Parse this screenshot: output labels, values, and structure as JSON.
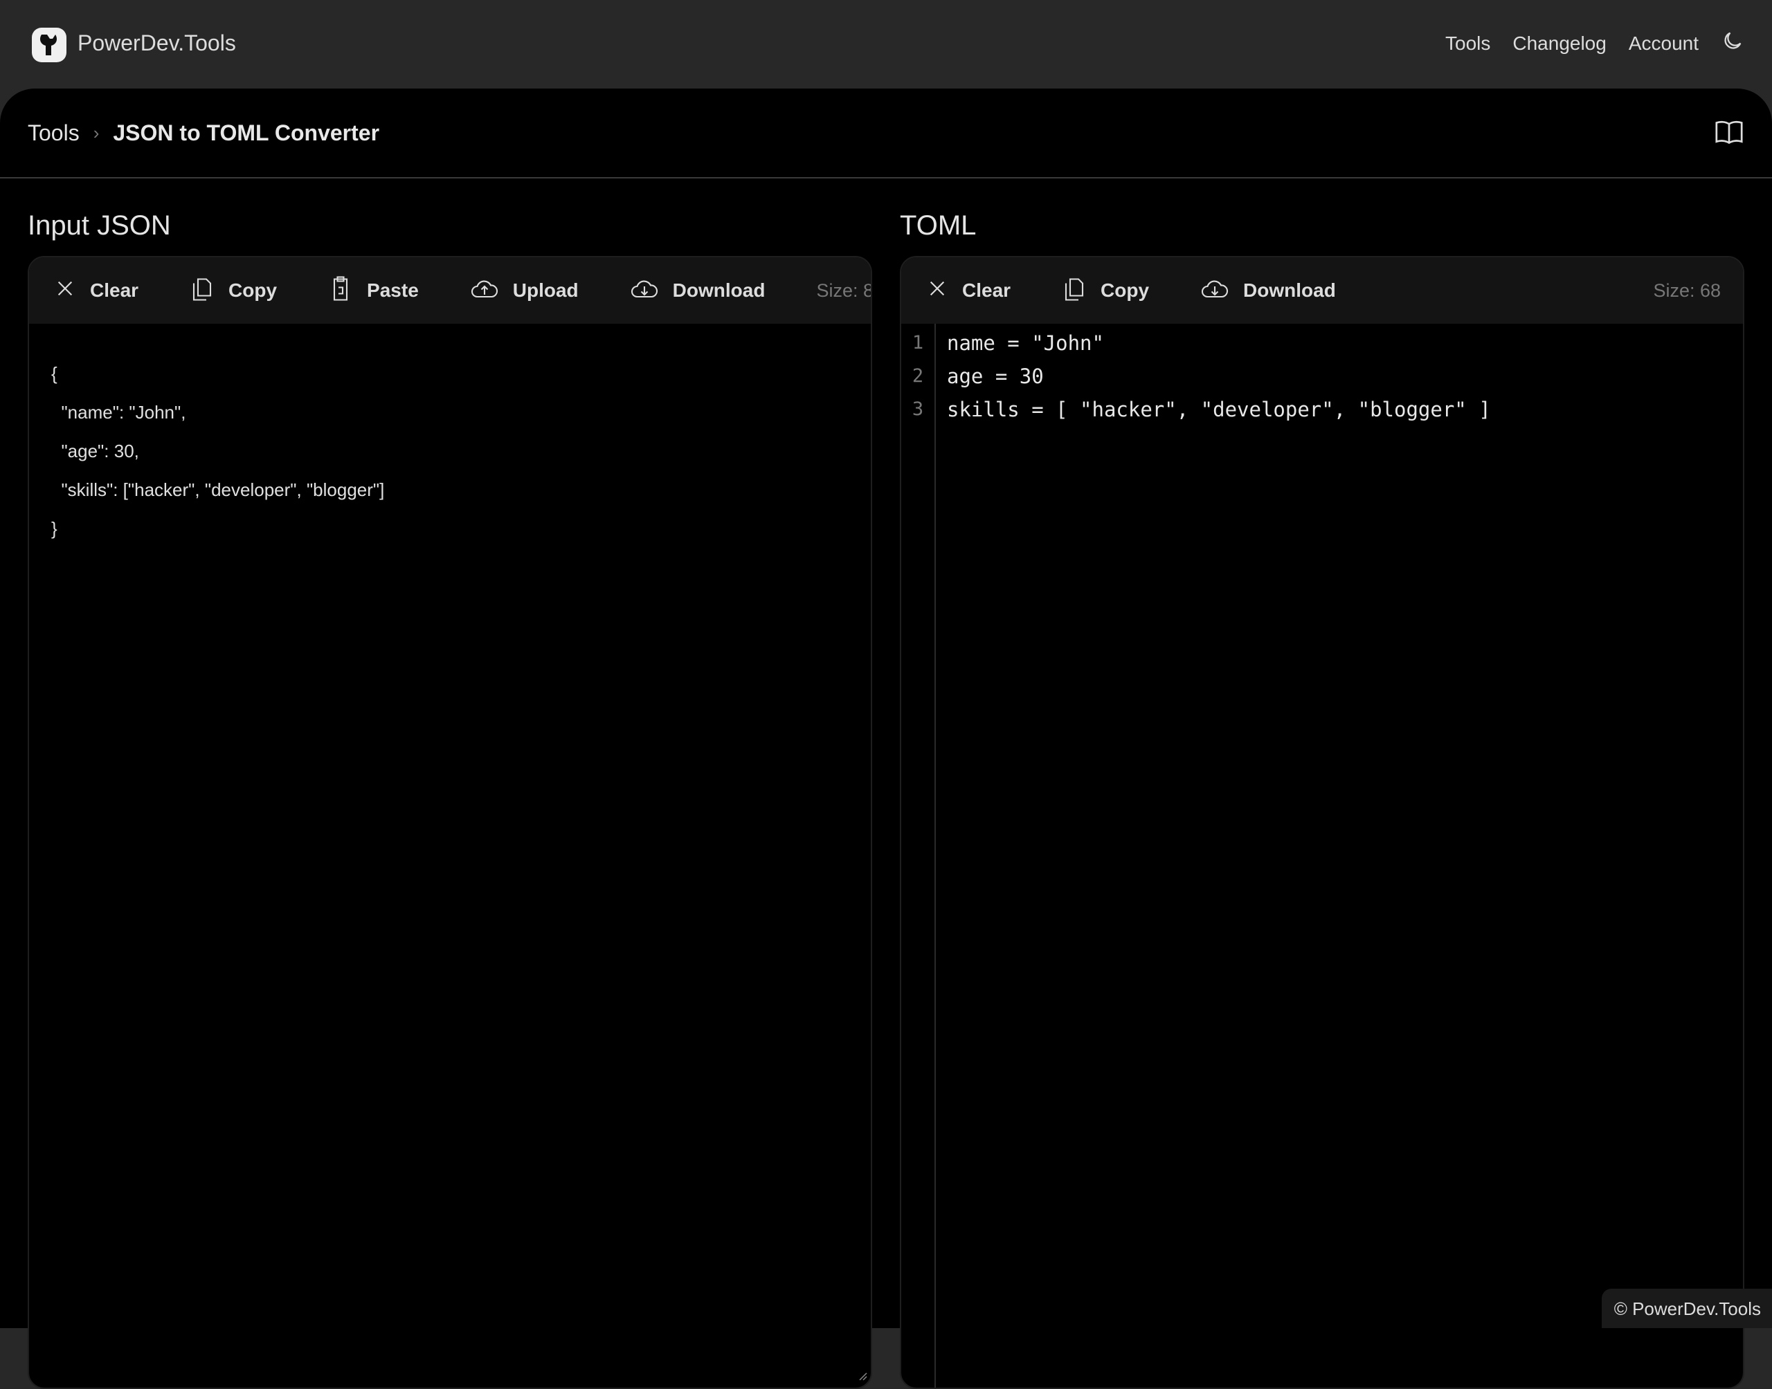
{
  "header": {
    "brand": "PowerDev.Tools",
    "nav": [
      "Tools",
      "Changelog",
      "Account"
    ]
  },
  "breadcrumb": {
    "root": "Tools",
    "current": "JSON to TOML Converter"
  },
  "input": {
    "title": "Input JSON",
    "buttons": [
      "Clear",
      "Copy",
      "Paste",
      "Upload",
      "Download"
    ],
    "size": "Size: 8",
    "content": "{\n  \"name\": \"John\",\n  \"age\": 30,\n  \"skills\": [\"hacker\", \"developer\", \"blogger\"]\n}"
  },
  "output": {
    "title": "TOML",
    "buttons": [
      "Clear",
      "Copy",
      "Download"
    ],
    "size": "Size: 68",
    "line_numbers": "1\n2\n3",
    "content": "name = \"John\"\nage = 30\nskills = [ \"hacker\", \"developer\", \"blogger\" ]"
  },
  "footer": "© PowerDev.Tools"
}
